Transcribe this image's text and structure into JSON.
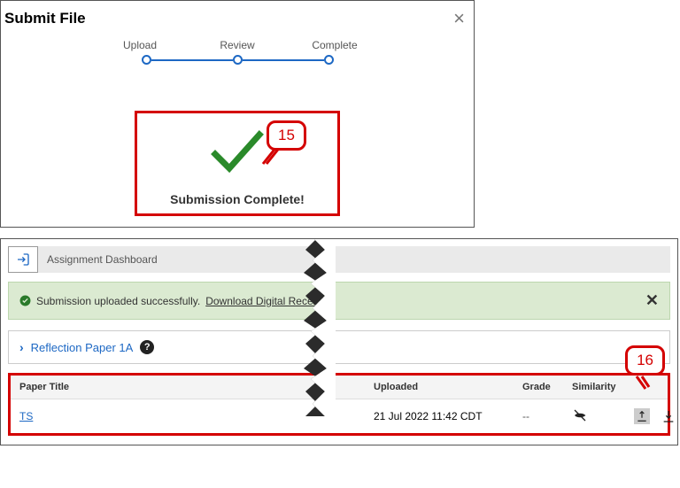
{
  "modal": {
    "title": "Submit File",
    "steps": [
      "Upload",
      "Review",
      "Complete"
    ],
    "callout15": "15",
    "complete_text": "Submission Complete!"
  },
  "dashboard": {
    "tab_label": "Assignment Dashboard",
    "banner": {
      "text": "Submission uploaded successfully.",
      "link": "Download Digital Receipt"
    },
    "assignment": {
      "title": "Reflection Paper 1A"
    },
    "callout16": "16",
    "table": {
      "headers": {
        "title": "Paper Title",
        "uploaded": "Uploaded",
        "grade": "Grade",
        "similarity": "Similarity"
      },
      "row": {
        "title": "TS",
        "uploaded": "21 Jul 2022 11:42 CDT",
        "grade": "--"
      }
    }
  }
}
